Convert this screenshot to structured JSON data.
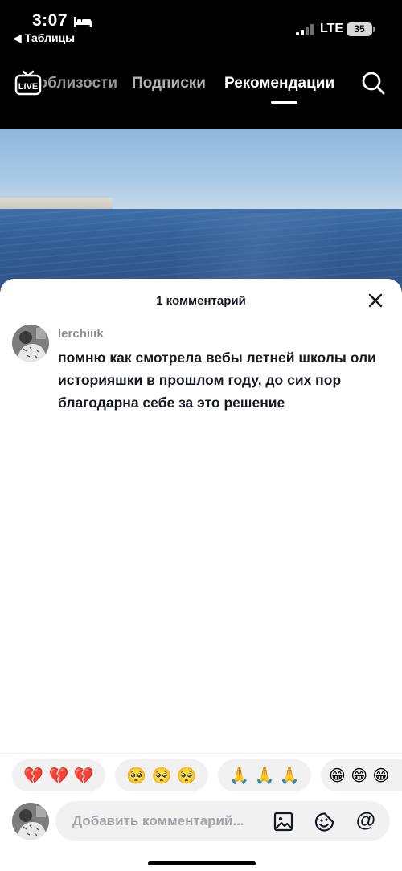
{
  "status_bar": {
    "time": "3:07",
    "back_app": "Таблицы",
    "network": "LTE",
    "battery": "35"
  },
  "nav": {
    "tabs": [
      {
        "label": "Поблизости"
      },
      {
        "label": "Подписки"
      },
      {
        "label": "Рекомендации"
      }
    ],
    "live_icon": "live-tv-icon",
    "search_icon": "search-icon"
  },
  "comments_sheet": {
    "title": "1 комментарий",
    "comments": [
      {
        "username": "lerchiiik",
        "text": "помню как смотрела вебы летней школы оли историяшки в прошлом году, до сих пор благодарна себе за это решение"
      }
    ],
    "quick_emojis": [
      "💔 💔 💔",
      "🥺 🥺 🥺",
      "🙏 🙏 🙏",
      "😁 😁 😁"
    ],
    "input": {
      "placeholder": "Добавить комментарий..."
    }
  },
  "colors": {
    "background": "#000000",
    "sheet": "#ffffff",
    "chip": "#f1f1f2",
    "text_primary": "#161823",
    "text_secondary": "#8a8b91"
  }
}
